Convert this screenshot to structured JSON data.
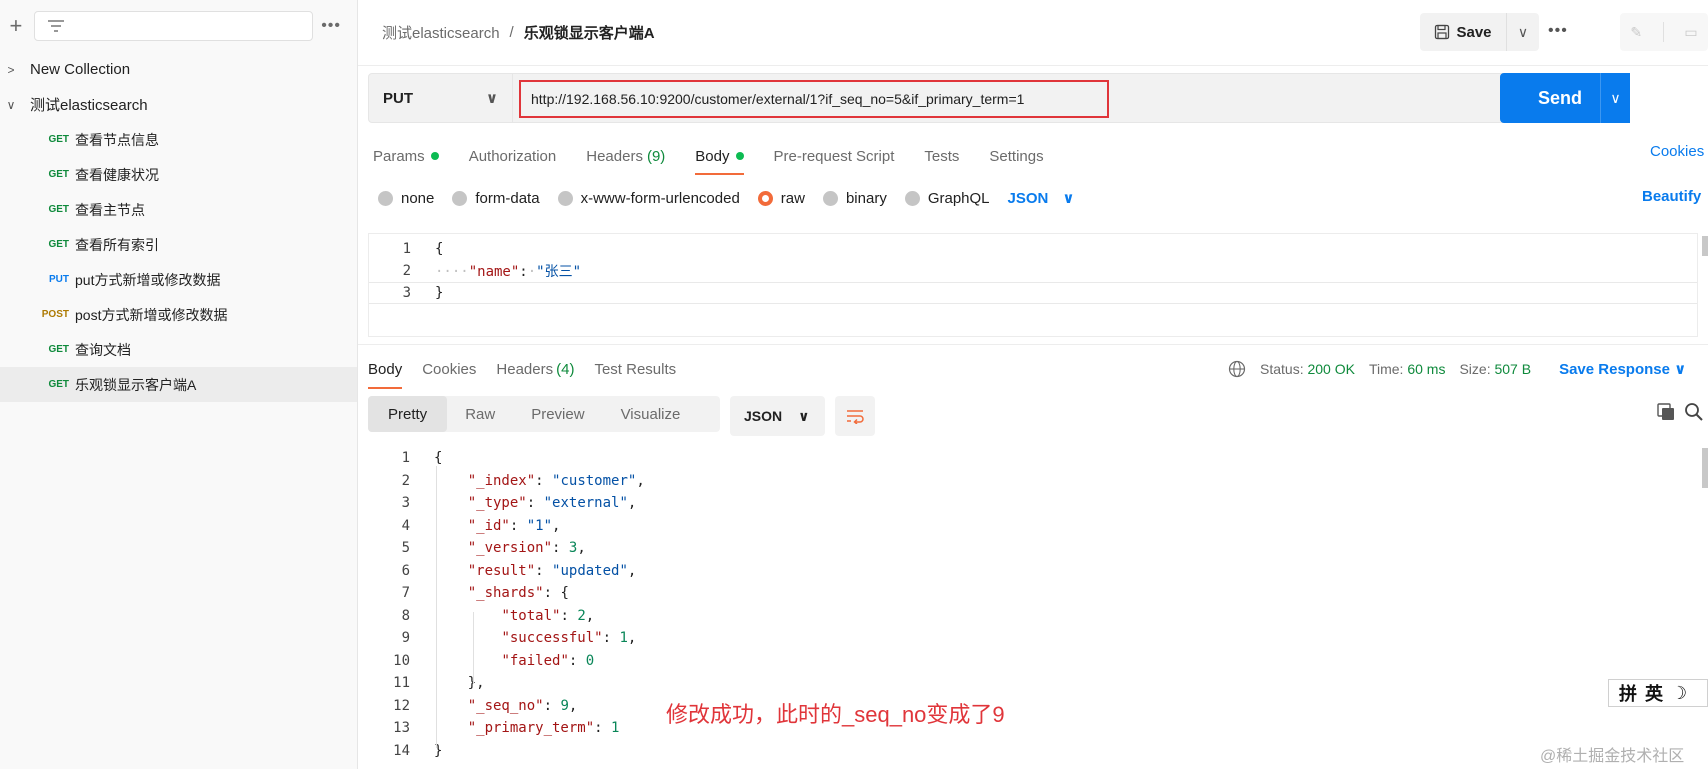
{
  "sidebar": {
    "filter_placeholder": "",
    "collections": [
      {
        "name": "New Collection",
        "expanded": false
      },
      {
        "name": "测试elasticsearch",
        "expanded": true
      }
    ],
    "requests": [
      {
        "method": "GET",
        "name": "查看节点信息"
      },
      {
        "method": "GET",
        "name": "查看健康状况"
      },
      {
        "method": "GET",
        "name": "查看主节点"
      },
      {
        "method": "GET",
        "name": "查看所有索引"
      },
      {
        "method": "PUT",
        "name": "put方式新增或修改数据"
      },
      {
        "method": "POST",
        "name": "post方式新增或修改数据"
      },
      {
        "method": "GET",
        "name": "查询文档"
      },
      {
        "method": "GET",
        "name": "乐观锁显示客户端A",
        "selected": true
      }
    ]
  },
  "header": {
    "breadcrumb_collection": "测试elasticsearch",
    "breadcrumb_separator": "/",
    "breadcrumb_request": "乐观锁显示客户端A",
    "save_label": "Save"
  },
  "request": {
    "method": "PUT",
    "url": "http://192.168.56.10:9200/customer/external/1?if_seq_no=5&if_primary_term=1",
    "send_label": "Send",
    "tabs": [
      {
        "label": "Params",
        "dot": true
      },
      {
        "label": "Authorization"
      },
      {
        "label": "Headers",
        "count": "(9)"
      },
      {
        "label": "Body",
        "dot": true,
        "active": true
      },
      {
        "label": "Pre-request Script"
      },
      {
        "label": "Tests"
      },
      {
        "label": "Settings"
      }
    ],
    "cookies_label": "Cookies",
    "body_types": [
      "none",
      "form-data",
      "x-www-form-urlencoded",
      "raw",
      "binary",
      "GraphQL"
    ],
    "body_type_selected": "raw",
    "raw_format": "JSON",
    "beautify_label": "Beautify",
    "body_lines": [
      "{",
      "····\"name\":·\"张三\"",
      "}"
    ]
  },
  "response": {
    "tabs": [
      {
        "label": "Body",
        "active": true
      },
      {
        "label": "Cookies"
      },
      {
        "label": "Headers",
        "count": "(4)"
      },
      {
        "label": "Test Results"
      }
    ],
    "status_label": "Status:",
    "status_value": "200 OK",
    "time_label": "Time:",
    "time_value": "60 ms",
    "size_label": "Size:",
    "size_value": "507 B",
    "save_response_label": "Save Response",
    "view_tabs": [
      "Pretty",
      "Raw",
      "Preview",
      "Visualize"
    ],
    "view_selected": "Pretty",
    "format": "JSON",
    "body_lines": [
      "{",
      "    \"_index\": \"customer\",",
      "    \"_type\": \"external\",",
      "    \"_id\": \"1\",",
      "    \"_version\": 3,",
      "    \"result\": \"updated\",",
      "    \"_shards\": {",
      "        \"total\": 2,",
      "        \"successful\": 1,",
      "        \"failed\": 0",
      "    },",
      "    \"_seq_no\": 9,",
      "    \"_primary_term\": 1",
      "}"
    ]
  },
  "annotation": "修改成功，此时的_seq_no变成了9",
  "ime": {
    "pin": "拼",
    "lang": "英"
  },
  "watermark": "@稀土掘金技术社区",
  "colors": {
    "accent": "#097bed",
    "tab_underline": "#f26b3a",
    "annotation": "#e0353a",
    "get": "#0f8a3c"
  }
}
